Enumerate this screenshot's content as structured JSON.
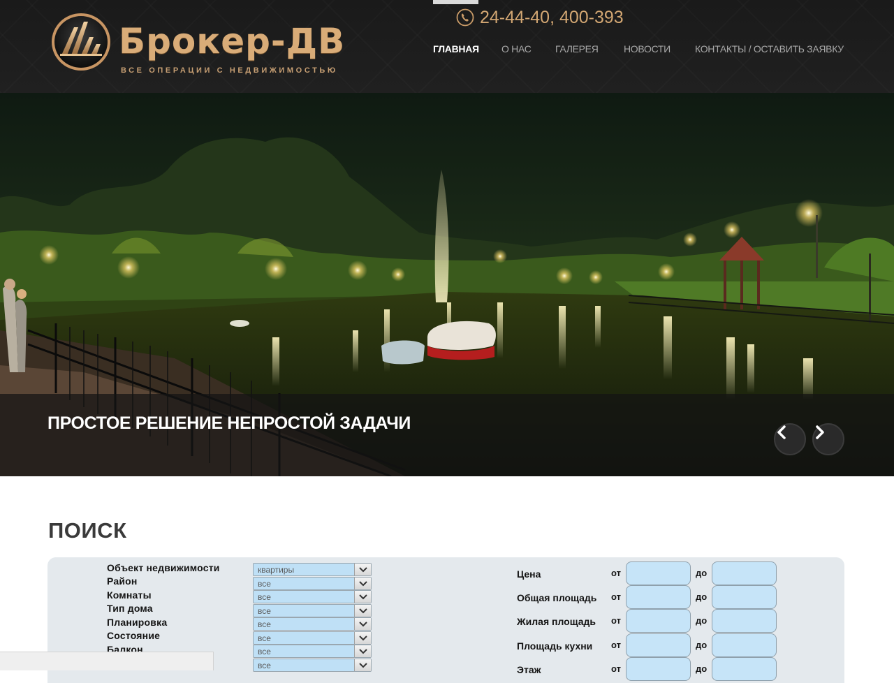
{
  "header": {
    "brand_name": "Брокер-ДВ",
    "brand_tagline": "ВСЕ ОПЕРАЦИИ С НЕДВИЖИМОСТЬЮ",
    "phone": "24-44-40, 400-393",
    "nav": [
      {
        "label": "ГЛАВНАЯ",
        "active": true
      },
      {
        "label": "О НАС",
        "active": false
      },
      {
        "label": "ГАЛЕРЕЯ",
        "active": false
      },
      {
        "label": "НОВОСТИ",
        "active": false
      },
      {
        "label": "КОНТАКТЫ / ОСТАВИТЬ ЗАЯВКУ",
        "active": false
      }
    ]
  },
  "slider": {
    "caption": "ПРОСТОЕ РЕШЕНИЕ НЕПРОСТОЙ ЗАДАЧИ",
    "prev_icon": "chevron-left-icon",
    "next_icon": "chevron-right-icon"
  },
  "search": {
    "title": "ПОИСК",
    "filters": [
      {
        "label": "Объект недвижимости",
        "value": "квартиры"
      },
      {
        "label": "Район",
        "value": "все"
      },
      {
        "label": "Комнаты",
        "value": "все"
      },
      {
        "label": "Тип дома",
        "value": "все"
      },
      {
        "label": "Планировка",
        "value": "все"
      },
      {
        "label": "Состояние",
        "value": "все"
      },
      {
        "label": "Балкон",
        "value": "все"
      },
      {
        "label": "",
        "value": "все"
      }
    ],
    "ranges": [
      {
        "label": "Цена",
        "from": "от",
        "to": "до"
      },
      {
        "label": "Общая площадь",
        "from": "от",
        "to": "до"
      },
      {
        "label": "Жилая площадь",
        "from": "от",
        "to": "до"
      },
      {
        "label": "Площадь кухни",
        "from": "от",
        "to": "до"
      },
      {
        "label": "Этаж",
        "from": "от",
        "to": "до"
      }
    ]
  },
  "colors": {
    "brand_gold": "#d9ac78",
    "header_bg": "#1d1d1d",
    "field_blue": "#c6e4f8",
    "panel_bg": "#e4e9ed"
  }
}
